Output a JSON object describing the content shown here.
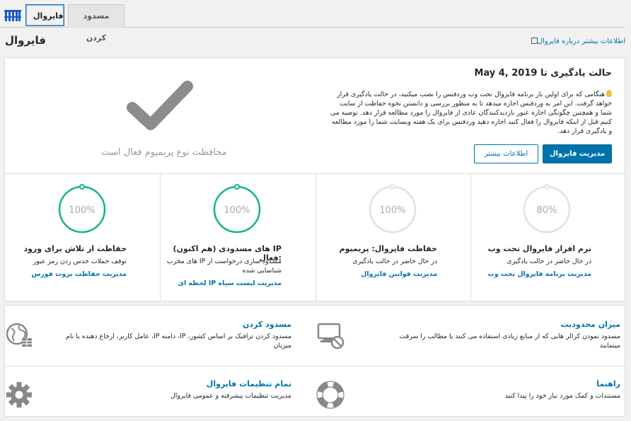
{
  "tabs": [
    {
      "label": "فایروال",
      "active": true
    },
    {
      "label": "مسدود کردن",
      "active": false
    }
  ],
  "page": {
    "title": "فایروال",
    "learn_link": "اطلاعات بیشتر درباره فایروال"
  },
  "status": {
    "premium_text": "محافظت نوع پریمیوم فعال است",
    "learning_title": "حالت یادگیری تا May 4, 2019",
    "learning_desc": "هنگامی که برای اولین بار برنامه فایروال تحت وب وردفنس را نصب میکنید، در حالت یادگیری قرار خواهد گرفت. این امر به وردفنس اجازه میدهد تا به منظور بررسی و دانستن نحوه حفاظت از سایت شما و همچنین چگونگی اجازه عبور بازدیدکنندگان عادی از فایروال را مورد مطالعه قرار دهد. توصیه می کنیم قبل از اینکه فایروال را فعال کنید اجازه دهید وردفنس برای یک هفته وبسایت شما را مورد مطالعه و یادگیری قرار دهد.",
    "manage_button": "مدیریت فایروال",
    "more_button": "اطلاعات بیشتر"
  },
  "stats": [
    {
      "percent": "80%",
      "fraction": 0.8,
      "title": "نرم افزار فایروال تحت وب",
      "desc": "در حال حاضر در حالت یادگیری",
      "link": "مدیریت برنامه فایروال تحت وب"
    },
    {
      "percent": "100%",
      "fraction": 1.0,
      "title": "حفاظت فایروال: پریمیوم",
      "desc": "در حال حاضر در حالت یادگیری",
      "link": "مدیریت قوانین فایروال"
    },
    {
      "percent": "100%",
      "fraction": 1.0,
      "title": "IP های مسدودی (هم اکنون) :فعال",
      "desc": "مسدود سازی درخواست از IP های مخرب شناسایی شده",
      "link": "مدیریت لیست سیاه IP لحظه ای"
    },
    {
      "percent": "100%",
      "fraction": 1.0,
      "title": "حفاظت از تلاش برای ورود",
      "desc": "توقف حملات حدس زدن رمز عبور",
      "link": "مدیریت حفاظت بروت فورس"
    }
  ],
  "tools": [
    {
      "title": "میزان محدودیت",
      "desc": "مسدود نمودن کرالر هایی که از منابع زیادی استفاده می کنند یا مطالب را سرقت مینمایند"
    },
    {
      "title": "مسدود کردن",
      "desc": "مسدود کردن ترافیک بر اساس کشور، IP، دامنه IP، عامل کاربر، ارجاع دهنده یا نام میزبان"
    },
    {
      "title": "راهنما",
      "desc": "مستندات و کمک مورد نیاز خود را پیدا کنید"
    },
    {
      "title": "تمام تنظیمات فایروال",
      "desc": "مدیریت تنظیمات پیشرفته و عمومی فایروال"
    }
  ],
  "colors": {
    "accent": "#0073aa",
    "ring_active": "#16b390",
    "ring_inactive": "#e2e2e2",
    "check": "#8c8c8c"
  }
}
